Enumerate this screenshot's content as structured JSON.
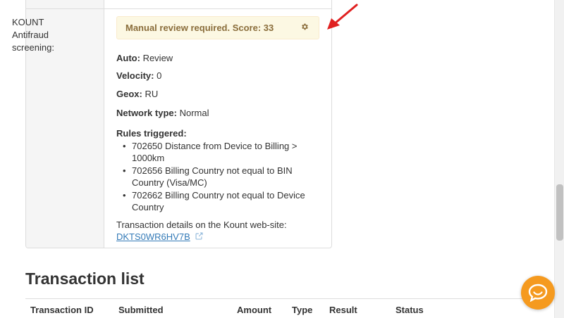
{
  "kount_section": {
    "label": "KOUNT Antifraud screening:",
    "alert_text": "Manual review required. Score: 33",
    "alert_color": "#8a6d3b",
    "auto_label": "Auto:",
    "auto_value": "Review",
    "velocity_label": "Velocity:",
    "velocity_value": "0",
    "geox_label": "Geox:",
    "geox_value": "RU",
    "network_label": "Network type:",
    "network_value": "Normal",
    "rules_title": "Rules triggered:",
    "rules": [
      "702650 Distance from Device to Billing > 1000km",
      "702656 Billing Country not equal to BIN Country (Visa/MC)",
      "702662 Billing Country not equal to Device Country"
    ],
    "details_text": "Transaction details on the Kount web-site:",
    "transaction_link": "DKTS0WR6HV7B"
  },
  "transaction_list": {
    "title": "Transaction list",
    "columns": [
      "Transaction ID",
      "Submitted",
      "Amount",
      "Type",
      "Result",
      "Status"
    ]
  },
  "colors": {
    "alert_bg": "#fcf8e3",
    "link": "#337ab7",
    "annotation_arrow": "#e02020",
    "chat_button": "#f59a1f"
  },
  "icons": {
    "alert_settings": "gear-icon",
    "link_external": "external-link-icon",
    "chat": "chat-bubble-icon",
    "annotation": "arrow-icon"
  }
}
